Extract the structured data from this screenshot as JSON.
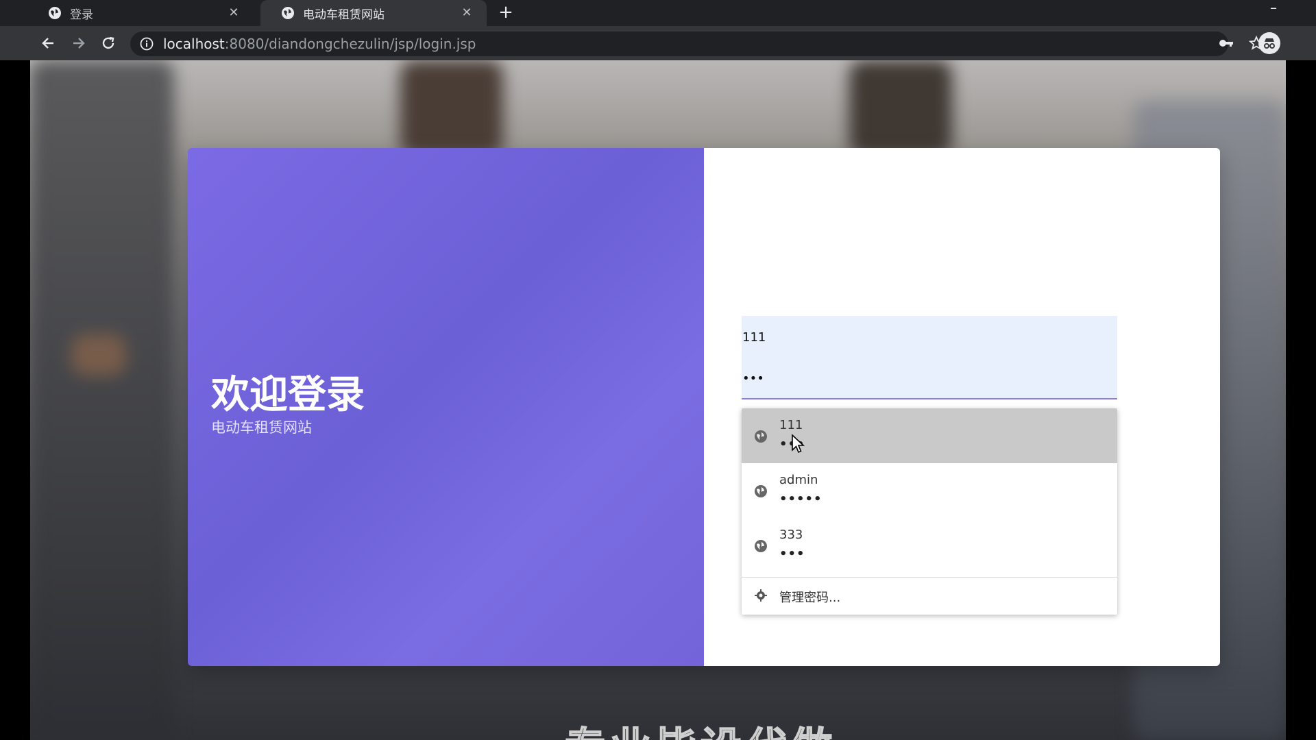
{
  "browser": {
    "tabs": [
      {
        "title": "登录",
        "active": false
      },
      {
        "title": "电动车租赁网站",
        "active": true
      }
    ],
    "url_host": "localhost",
    "url_rest": ":8080/diandongchezulin/jsp/login.jsp"
  },
  "page": {
    "welcome_title": "欢迎登录",
    "welcome_subtitle": "电动车租赁网站",
    "username_value": "111",
    "password_value": "•••",
    "overlay_caption": "专业毕设代做"
  },
  "autofill": {
    "items": [
      {
        "user": "111",
        "pass": "•••",
        "selected": true
      },
      {
        "user": "admin",
        "pass": "•••••",
        "selected": false
      },
      {
        "user": "333",
        "pass": "•••",
        "selected": false
      }
    ],
    "manage_label": "管理密码..."
  },
  "colors": {
    "accent": "#6c60d6",
    "autofill_bg": "#e8f0fe",
    "selected_row": "#c9c9c9"
  }
}
